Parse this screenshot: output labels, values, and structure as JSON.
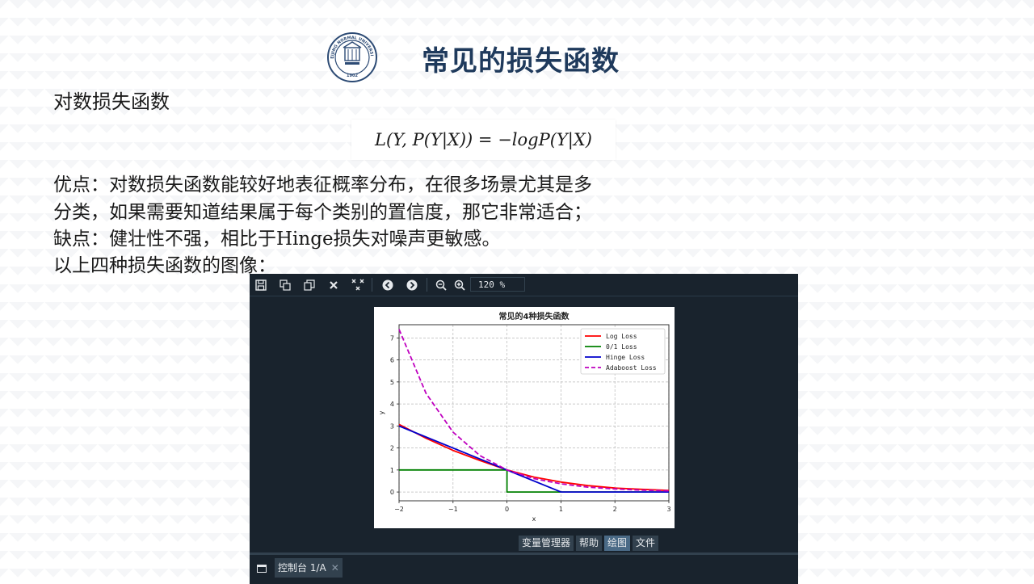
{
  "slide": {
    "title": "常见的损失函数",
    "heading": "对数损失函数",
    "formula": "L(Y, P(Y|X)) = −logP(Y|X)",
    "paragraphs": [
      "优点：对数损失函数能较好地表征概率分布，在很多场景尤其是多",
      "分类，如果需要知道结果属于每个类别的置信度，那它非常适合；",
      "缺点：健壮性不强，相比于Hinge损失对噪声更敏感。",
      "以上四种损失函数的图像："
    ],
    "logo": {
      "top_text": "BEIJING NORMAL UNIVERSITY",
      "year": "1902"
    }
  },
  "viewer": {
    "zoom": "120 %",
    "toolbar_icons": [
      "save-icon",
      "save-all-icon",
      "copy-icon",
      "close-icon",
      "close-all-icon",
      "previous-icon",
      "next-icon",
      "zoom-out-icon",
      "zoom-in-icon"
    ],
    "pane_tabs": [
      "变量管理器",
      "帮助",
      "绘图",
      "文件"
    ],
    "active_tab": "绘图",
    "console_tab": "控制台 1/A"
  },
  "chart_data": {
    "type": "line",
    "title": "常见的4种损失函数",
    "xlabel": "x",
    "ylabel": "y",
    "xlim": [
      -2,
      3
    ],
    "ylim": [
      -0.4,
      7.6
    ],
    "xticks": [
      -2,
      -1,
      0,
      1,
      2,
      3
    ],
    "yticks": [
      0,
      1,
      2,
      3,
      4,
      5,
      6,
      7
    ],
    "grid": true,
    "legend_position": "top-right",
    "series": [
      {
        "name": "Log Loss",
        "color": "#ff0000",
        "dash": false,
        "x": [
          -2,
          -1.5,
          -1,
          -0.5,
          0,
          0.5,
          1,
          1.5,
          2,
          2.5,
          3
        ],
        "y": [
          3.07,
          2.44,
          1.89,
          1.43,
          1.0,
          0.68,
          0.45,
          0.29,
          0.18,
          0.12,
          0.07
        ]
      },
      {
        "name": "0/1 Loss",
        "color": "#008000",
        "dash": false,
        "x": [
          -2,
          0,
          0,
          3
        ],
        "y": [
          1,
          1,
          0,
          0
        ]
      },
      {
        "name": "Hinge Loss",
        "color": "#0000cc",
        "dash": false,
        "x": [
          -2,
          1,
          3
        ],
        "y": [
          3,
          0,
          0
        ]
      },
      {
        "name": "Adaboost Loss",
        "color": "#bf00bf",
        "dash": true,
        "x": [
          -2,
          -1.5,
          -1,
          -0.5,
          0,
          0.5,
          1,
          1.5,
          2,
          2.5,
          3
        ],
        "y": [
          7.39,
          4.48,
          2.72,
          1.65,
          1.0,
          0.61,
          0.37,
          0.22,
          0.14,
          0.08,
          0.05
        ]
      }
    ]
  }
}
